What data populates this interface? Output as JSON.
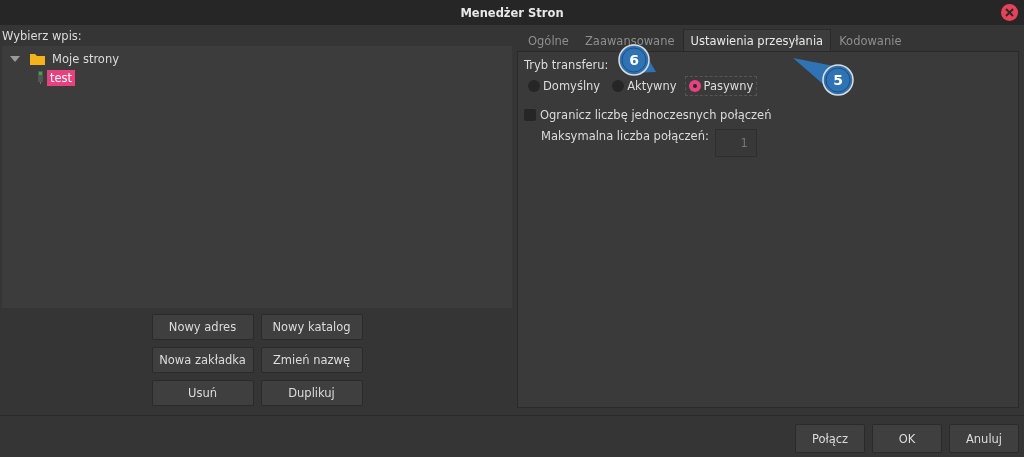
{
  "window": {
    "title": "Menedżer Stron"
  },
  "entries": {
    "label": "Wybierz wpis:",
    "tree": [
      {
        "label": "Moje strony",
        "kind": "folder",
        "expanded": true,
        "selected": false,
        "children": [
          {
            "label": "test",
            "kind": "site",
            "selected": true
          }
        ]
      }
    ]
  },
  "entry_buttons": [
    "Nowy adres",
    "Nowy katalog",
    "Nowa zakładka",
    "Zmień nazwę",
    "Usuń",
    "Duplikuj"
  ],
  "tabs": [
    {
      "label": "Ogólne",
      "selected": false
    },
    {
      "label": "Zaawansowane",
      "selected": false
    },
    {
      "label": "Ustawienia przesyłania",
      "selected": true
    },
    {
      "label": "Kodowanie",
      "selected": false
    }
  ],
  "transfer": {
    "label": "Tryb transferu:",
    "modes": [
      {
        "label": "Domyślny",
        "selected": false
      },
      {
        "label": "Aktywny",
        "selected": false
      },
      {
        "label": "Pasywny",
        "selected": true
      }
    ],
    "limit": {
      "label": "Ogranicz liczbę jednoczesnych połączeń",
      "checked": false
    },
    "max": {
      "label": "Maksymalna liczba połączeń:",
      "value": "1",
      "disabled": true
    }
  },
  "footer_buttons": [
    "Połącz",
    "OK",
    "Anuluj"
  ],
  "callouts": [
    {
      "label": "6"
    },
    {
      "label": "5"
    }
  ]
}
